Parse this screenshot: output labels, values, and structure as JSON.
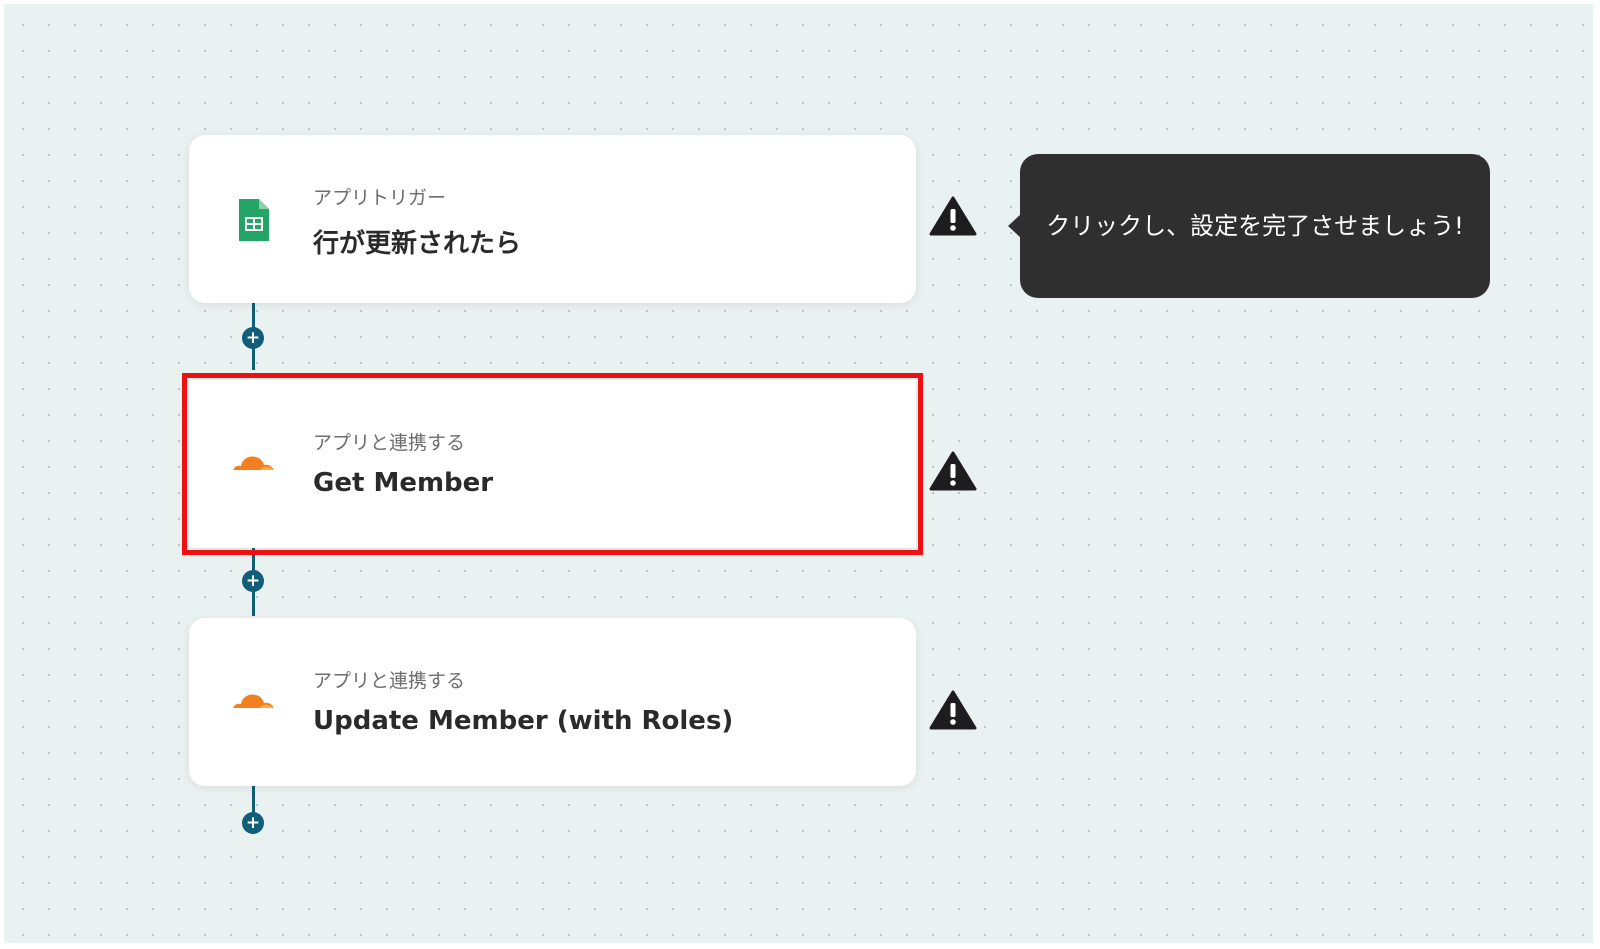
{
  "flow": {
    "steps": [
      {
        "subtitle": "アプリトリガー",
        "title": "行が更新されたら",
        "icon": "google-sheets-icon",
        "icon_color": "#23a566"
      },
      {
        "subtitle": "アプリと連携する",
        "title": "Get Member",
        "icon": "cloudflare-icon",
        "icon_color": "#f38020",
        "highlighted": true
      },
      {
        "subtitle": "アプリと連携する",
        "title": "Update Member (with Roles)",
        "icon": "cloudflare-icon",
        "icon_color": "#f38020"
      }
    ],
    "add_step_icon": "plus-icon",
    "warning_icon": "warning-triangle-icon"
  },
  "tooltip": {
    "text": "クリックし、設定を完了させましょう!"
  },
  "colors": {
    "canvas_bg": "#eaf1f1",
    "connector": "#115e7a",
    "highlight_border": "#ee1111",
    "tooltip_bg": "#2f2f2f"
  }
}
